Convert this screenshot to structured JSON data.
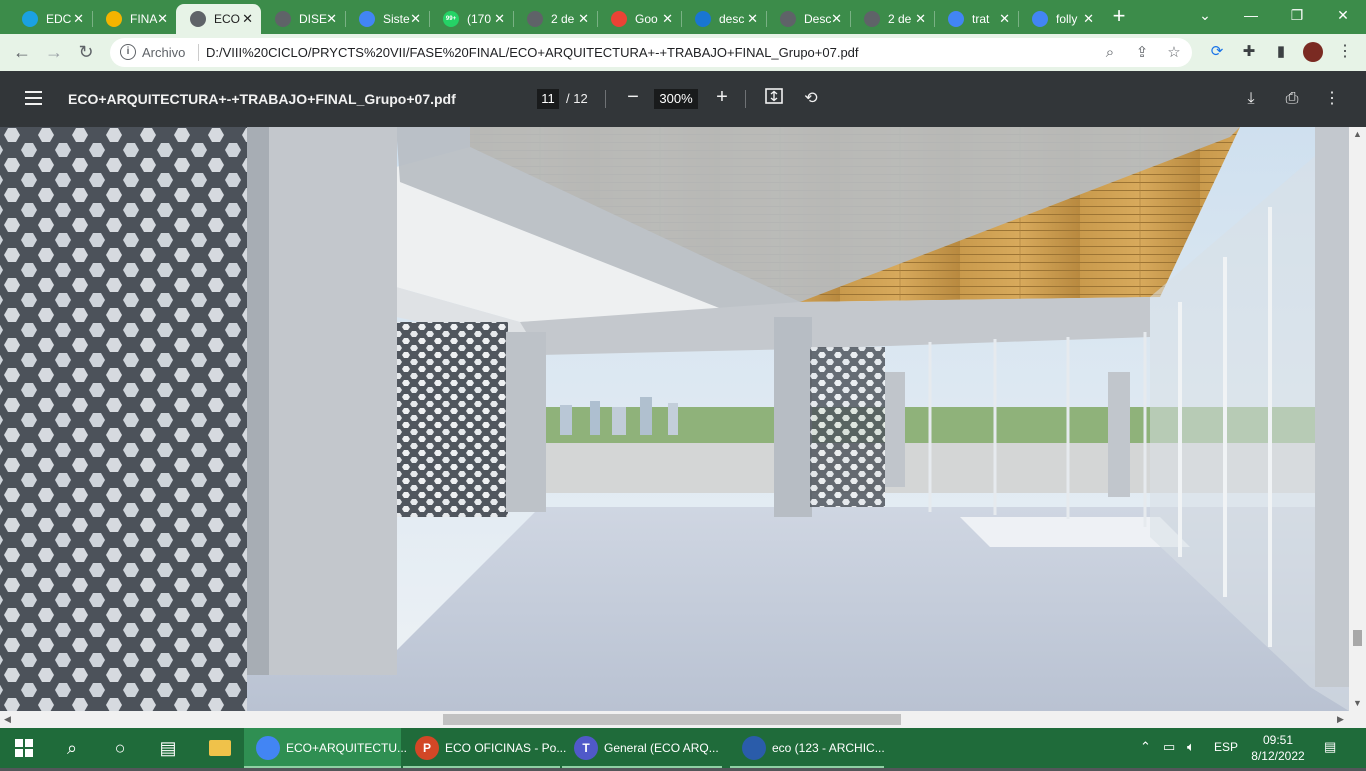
{
  "browser": {
    "tabs": [
      {
        "title": "EDC",
        "icon": "edge-icon",
        "color": "#1ba1e2"
      },
      {
        "title": "FINA",
        "icon": "slides-icon",
        "color": "#f4b400"
      },
      {
        "title": "ECO",
        "icon": "globe-icon",
        "color": "#5f6368",
        "active": true
      },
      {
        "title": "DISE",
        "icon": "globe-icon",
        "color": "#5f6368"
      },
      {
        "title": "Siste",
        "icon": "google-icon",
        "color": "#4285f4"
      },
      {
        "title": "(170",
        "icon": "whatsapp-icon",
        "color": "#25d366",
        "badge": "99+"
      },
      {
        "title": "2 de",
        "icon": "globe-icon",
        "color": "#5f6368"
      },
      {
        "title": "Goo",
        "icon": "google-photos-icon",
        "color": "#ea4335"
      },
      {
        "title": "desc",
        "icon": "wave-icon",
        "color": "#1976d2"
      },
      {
        "title": "Desc",
        "icon": "download-icon",
        "color": "#5f6368"
      },
      {
        "title": "2 de",
        "icon": "globe-icon",
        "color": "#5f6368"
      },
      {
        "title": "trat",
        "icon": "google-icon",
        "color": "#4285f4"
      },
      {
        "title": "folly",
        "icon": "google-icon",
        "color": "#4285f4"
      }
    ],
    "address": {
      "chip": "Archivo",
      "url": "D:/VIII%20CICLO/PRYCTS%20VII/FASE%20FINAL/ECO+ARQUITECTURA+-+TRABAJO+FINAL_Grupo+07.pdf"
    }
  },
  "pdf": {
    "title": "ECO+ARQUITECTURA+-+TRABAJO+FINAL_Grupo+07.pdf",
    "current_page": "11",
    "total_pages": "/ 12",
    "zoom": "300%"
  },
  "taskbar": {
    "apps": [
      {
        "label": "ECO+ARQUITECTU...",
        "icon": "chrome-icon",
        "color": "#4285f4",
        "active": true
      },
      {
        "label": "ECO OFICINAS - Po...",
        "icon": "powerpoint-icon",
        "color": "#d24726",
        "letter": "P"
      },
      {
        "label": "General (ECO ARQ...",
        "icon": "teams-icon",
        "color": "#5059c9",
        "letter": "T"
      },
      {
        "label": "eco (123 - ARCHIC...",
        "icon": "archicad-icon",
        "color": "#2a5caa"
      }
    ],
    "language": "ESP",
    "time": "09:51",
    "date": "8/12/2022"
  }
}
